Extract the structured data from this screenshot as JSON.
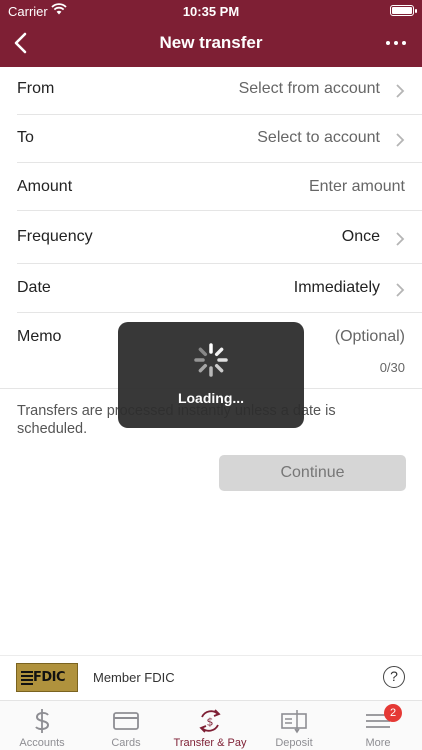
{
  "status": {
    "carrier": "Carrier",
    "time": "10:35 PM"
  },
  "nav": {
    "title": "New transfer"
  },
  "form": {
    "from": {
      "label": "From",
      "value": "Select from account"
    },
    "to": {
      "label": "To",
      "value": "Select to account"
    },
    "amount": {
      "label": "Amount",
      "placeholder": "Enter amount"
    },
    "frequency": {
      "label": "Frequency",
      "value": "Once"
    },
    "date": {
      "label": "Date",
      "value": "Immediately"
    },
    "memo": {
      "label": "Memo",
      "placeholder": "(Optional)",
      "counter": "0/30"
    }
  },
  "note": "Transfers are processed instantly unless a date is scheduled.",
  "continue_label": "Continue",
  "loading": {
    "text": "Loading..."
  },
  "footer": {
    "logo_text": "FDIC",
    "member_text": "Member FDIC",
    "help": "?"
  },
  "tabs": [
    {
      "label": "Accounts",
      "icon": "dollar-icon"
    },
    {
      "label": "Cards",
      "icon": "card-icon"
    },
    {
      "label": "Transfer & Pay",
      "icon": "transfer-icon"
    },
    {
      "label": "Deposit",
      "icon": "check-deposit-icon"
    },
    {
      "label": "More",
      "icon": "menu-icon",
      "badge": "2"
    }
  ],
  "colors": {
    "brand": "#7e1f34",
    "badge": "#e53935"
  }
}
